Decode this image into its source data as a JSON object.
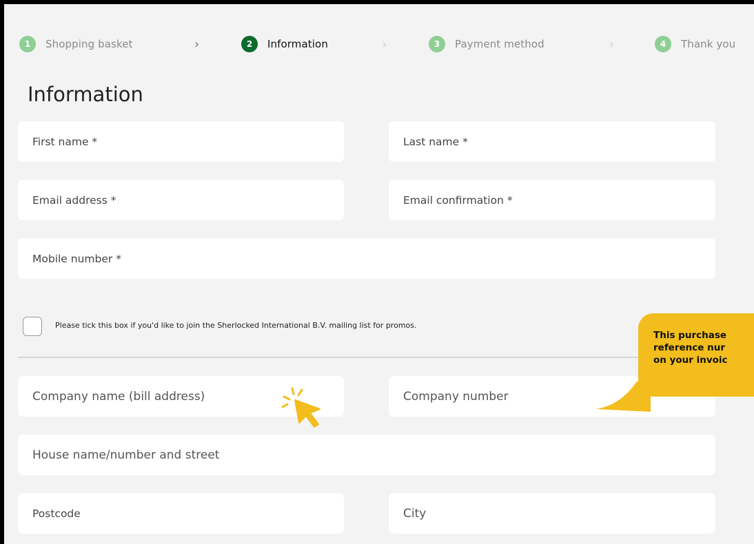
{
  "steps": [
    {
      "number": "1",
      "label": "Shopping basket"
    },
    {
      "number": "2",
      "label": "Information"
    },
    {
      "number": "3",
      "label": "Payment method"
    },
    {
      "number": "4",
      "label": "Thank you"
    }
  ],
  "page_title": "Information",
  "form": {
    "first_name": "First name *",
    "last_name": "Last name *",
    "email": "Email address *",
    "email_confirm": "Email confirmation *",
    "mobile": "Mobile number *",
    "mailing_consent": "Please tick this box if you'd like to join the Sherlocked International B.V. mailing list for promos.",
    "company_name": "Company name (bill address)",
    "company_number": "Company number",
    "street": "House name/number and street",
    "postcode": "Postcode",
    "city": "City"
  },
  "callout": {
    "lines": [
      "This purchase",
      "reference nur",
      "on your invoic"
    ]
  },
  "colors": {
    "active_step": "#0d6b2b",
    "inactive_step": "#8fcf95",
    "callout": "#f2bd1d"
  }
}
